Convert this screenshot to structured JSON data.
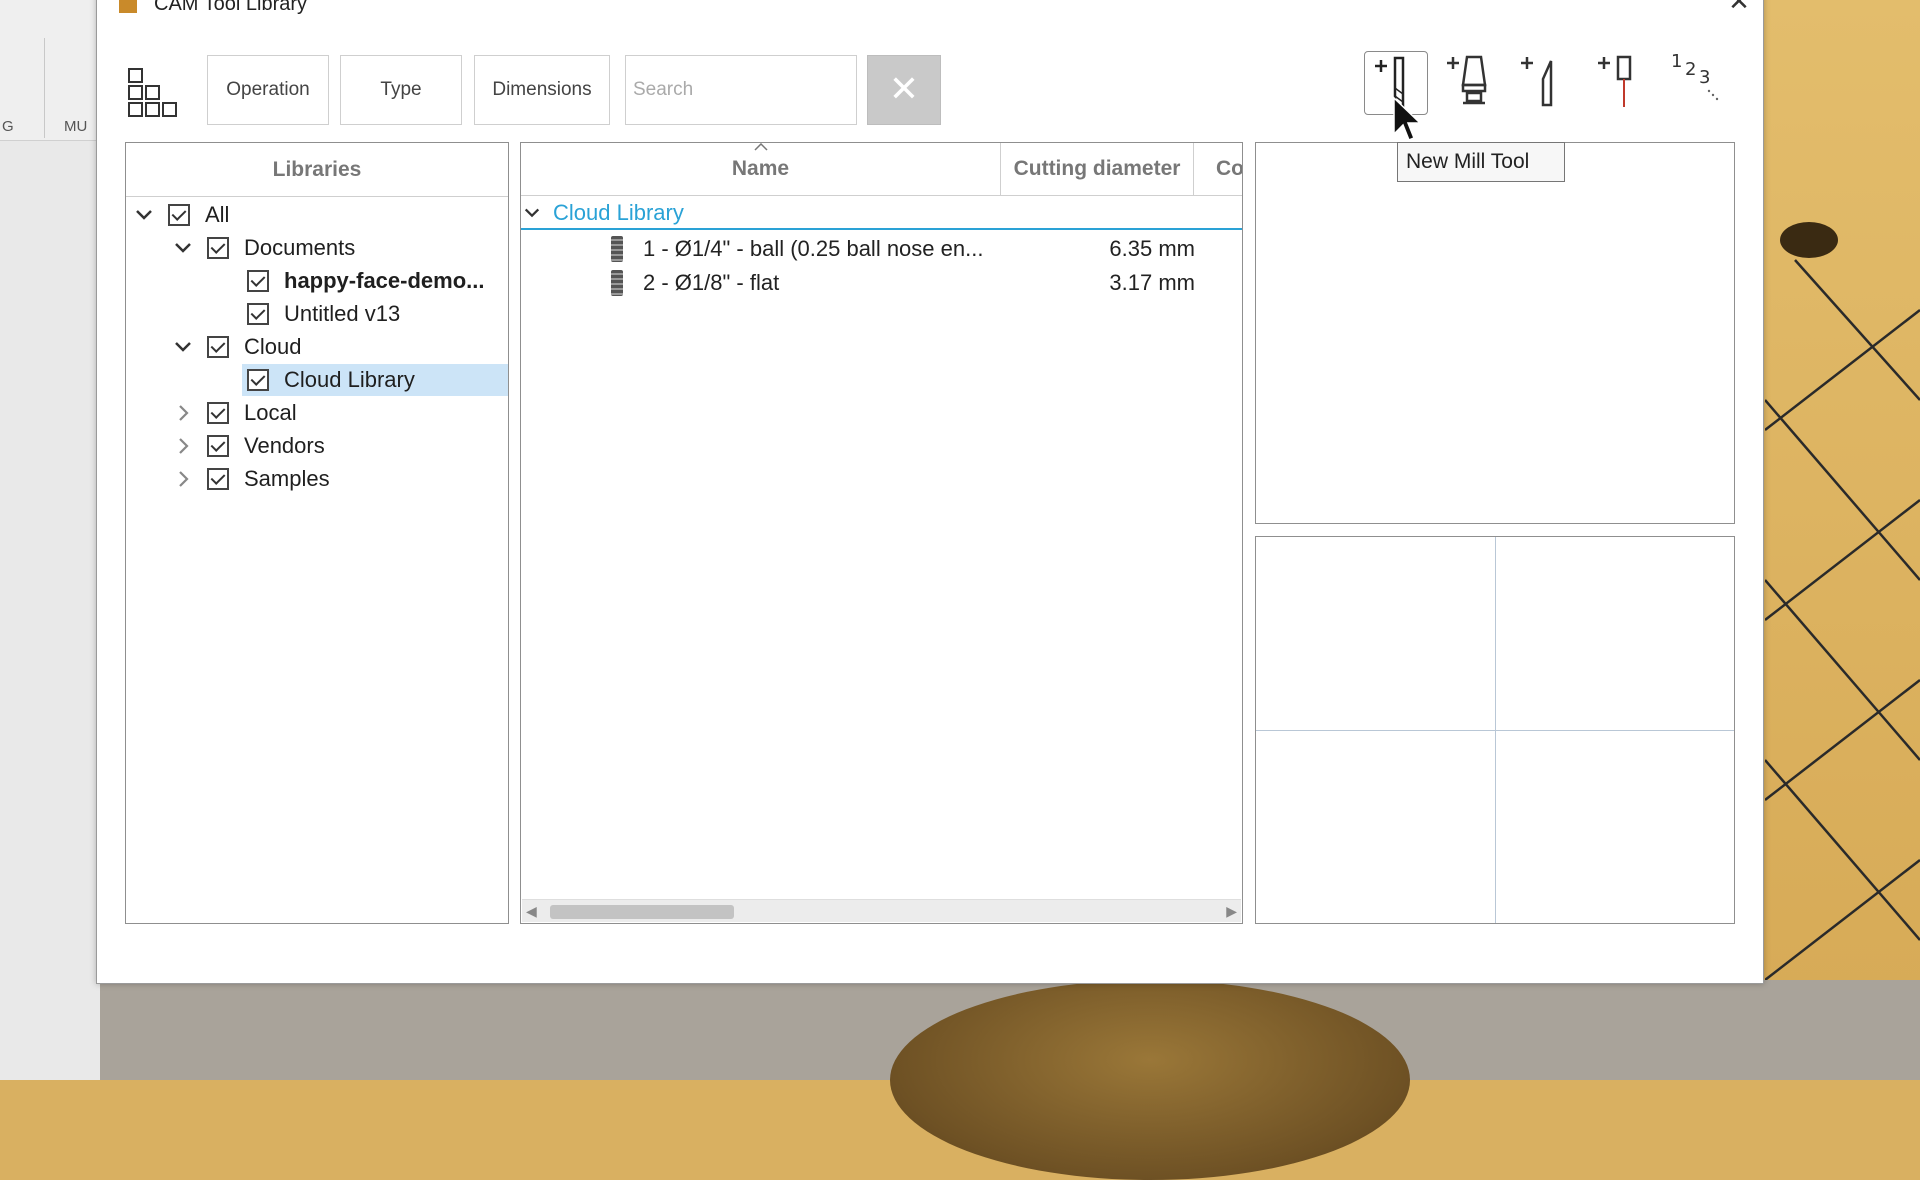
{
  "background": {
    "left_labels": [
      "G",
      "MU"
    ]
  },
  "dialog": {
    "title": "CAM Tool Library",
    "close_glyph": "✕"
  },
  "toolbar": {
    "operation_label": "Operation",
    "type_label": "Type",
    "dimensions_label": "Dimensions",
    "search_placeholder": "Search",
    "clear_glyph": "✕",
    "tool_icons": [
      "new-mill-tool-icon",
      "new-holder-icon",
      "new-turning-tool-icon",
      "new-probe-icon",
      "renumber-icon"
    ]
  },
  "libraries": {
    "header": "Libraries",
    "items": [
      {
        "label": "All",
        "level": 0,
        "expanded": true,
        "checked": true
      },
      {
        "label": "Documents",
        "level": 1,
        "expanded": true,
        "checked": true
      },
      {
        "label": "happy-face-demo...",
        "level": 2,
        "checked": true,
        "bold": true
      },
      {
        "label": "Untitled v13",
        "level": 2,
        "checked": true
      },
      {
        "label": "Cloud",
        "level": 1,
        "expanded": true,
        "checked": true
      },
      {
        "label": "Cloud Library",
        "level": 2,
        "checked": true,
        "selected": true
      },
      {
        "label": "Local",
        "level": 1,
        "expanded": false,
        "checked": true
      },
      {
        "label": "Vendors",
        "level": 1,
        "expanded": false,
        "checked": true
      },
      {
        "label": "Samples",
        "level": 1,
        "expanded": false,
        "checked": true
      }
    ]
  },
  "tools_table": {
    "columns": [
      "Name",
      "Cutting diameter",
      "Co"
    ],
    "group": "Cloud Library",
    "rows": [
      {
        "name": "1 - Ø1/4\" - ball (0.25 ball nose en...",
        "diameter": "6.35 mm"
      },
      {
        "name": "2 - Ø1/8\" - flat",
        "diameter": "3.17 mm"
      }
    ]
  },
  "tooltip": "New Mill Tool",
  "colors": {
    "accent": "#2aa2d6",
    "selection": "#cce4f7"
  }
}
